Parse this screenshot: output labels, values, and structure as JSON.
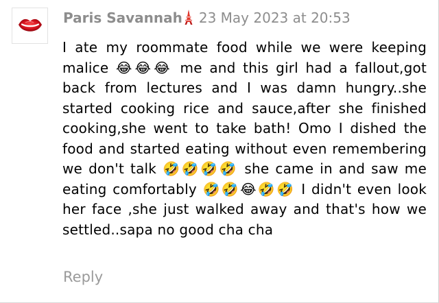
{
  "comment": {
    "author": "Paris Savannah",
    "author_badge_icon": "tokyo-tower-icon",
    "date": "23 May 2023 at 20:53",
    "avatar_icon": "red-lips-logo-icon",
    "body": "I ate my roommate food while we were keeping malice 😂😂😂 me and this girl had a fallout,got back from lectures and I was damn hungry..she started cooking rice and sauce,after she finished cooking,she went to take bath! Omo I dished the food and started eating without even remembering we don't talk 🤣🤣🤣🤣 she came in and saw me eating comfortably 🤣🤣😂🤣🤣 I didn't even look her face ,she just walked away and that's how we settled..sapa no good cha cha",
    "reply_label": "Reply"
  },
  "colors": {
    "meta_text": "#8d8d8d",
    "reply_text": "#9a9a9a",
    "avatar_red": "#c8102e"
  }
}
